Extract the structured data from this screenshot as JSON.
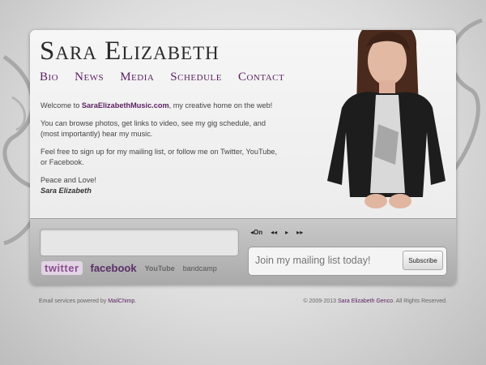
{
  "site": {
    "title": "Sara Elizabeth"
  },
  "nav": {
    "items": [
      "Bio",
      "News",
      "Media",
      "Schedule",
      "Contact"
    ]
  },
  "intro": {
    "welcome_prefix": "Welcome to ",
    "welcome_link": "SaraElizabethMusic.com",
    "welcome_suffix": ", my creative home on the web!",
    "para2": "You can browse photos, get links to video, see my gig schedule, and (most importantly) hear my music.",
    "para3": "Feel free to sign up for my mailing list, or follow me on Twitter, YouTube, or Facebook.",
    "closing": "Peace and Love!",
    "signature": "Sara Elizabeth"
  },
  "player": {
    "on_label": "On",
    "prev_glyph": "◂◂",
    "play_glyph": "▸",
    "next_glyph": "▸▸",
    "toggle_glyph": "◂"
  },
  "social": {
    "twitter": "twitter",
    "facebook": "facebook",
    "youtube": "YouTube",
    "bandcamp": "bandcamp"
  },
  "mailing": {
    "placeholder": "Join my mailing list today!",
    "button": "Subscribe"
  },
  "footer": {
    "left_prefix": "Email services powered by ",
    "left_link": "MailChimp",
    "left_suffix": ".",
    "right_prefix": "© 2009-2013 ",
    "right_link": "Sara Elizabeth Genco",
    "right_suffix": ". All Rights Reserved."
  },
  "colors": {
    "accent": "#5a1f62",
    "background": "#d8d8d8"
  }
}
